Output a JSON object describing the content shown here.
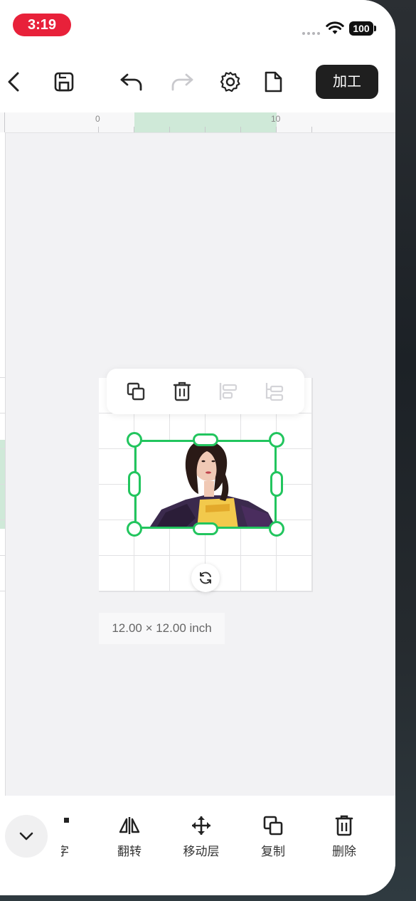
{
  "status_bar": {
    "time": "3:19",
    "battery": "100"
  },
  "toolbar": {
    "process_label": "加工"
  },
  "ruler": {
    "labels": [
      "0",
      "10"
    ]
  },
  "canvas": {
    "size_text": "12.00 × 12.00 inch"
  },
  "bottom_tools": [
    {
      "label": "字",
      "icon": "text-icon"
    },
    {
      "label": "翻转",
      "icon": "flip-icon"
    },
    {
      "label": "移动层",
      "icon": "move-icon"
    },
    {
      "label": "复制",
      "icon": "copy-icon"
    },
    {
      "label": "删除",
      "icon": "trash-icon"
    }
  ],
  "colors": {
    "accent": "#22c55e",
    "time_pill": "#e8213a",
    "ruler_highlight": "#cfe9d8"
  }
}
